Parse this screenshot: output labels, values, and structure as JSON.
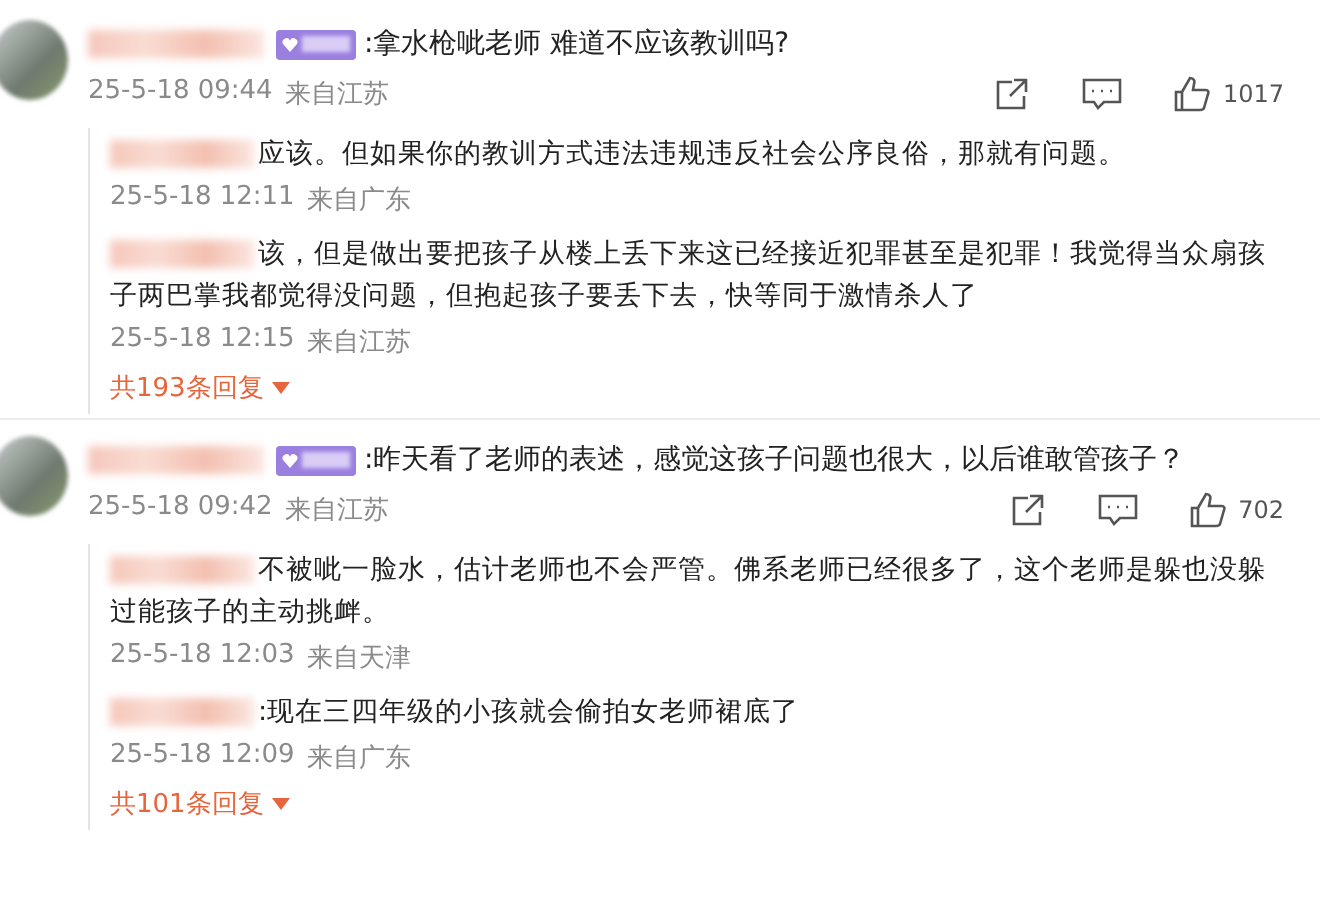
{
  "comments": [
    {
      "text": ":拿水枪呲老师 难道不应该教训吗?",
      "time": "25-5-18 09:44",
      "location": "来自江苏",
      "like_count": "1017",
      "replies": [
        {
          "text": "应该。但如果你的教训方式违法违规违反社会公序良俗，那就有问题。",
          "time": "25-5-18 12:11",
          "location": "来自广东"
        },
        {
          "text": "该，但是做出要把孩子从楼上丢下来这已经接近犯罪甚至是犯罪！我觉得当众扇孩子两巴掌我都觉得没问题，但抱起孩子要丢下去，快等同于激情杀人了",
          "time": "25-5-18 12:15",
          "location": "来自江苏"
        }
      ],
      "more_replies": "共193条回复"
    },
    {
      "text": ":昨天看了老师的表述，感觉这孩子问题也很大，以后谁敢管孩子？",
      "time": "25-5-18 09:42",
      "location": "来自江苏",
      "like_count": "702",
      "replies": [
        {
          "text": "不被呲一脸水，估计老师也不会严管。佛系老师已经很多了，这个老师是躲也没躲过能孩子的主动挑衅。",
          "time": "25-5-18 12:03",
          "location": "来自天津"
        },
        {
          "text": ":现在三四年级的小孩就会偷拍女老师裙底了",
          "time": "25-5-18 12:09",
          "location": "来自广东"
        }
      ],
      "more_replies": "共101条回复"
    }
  ]
}
